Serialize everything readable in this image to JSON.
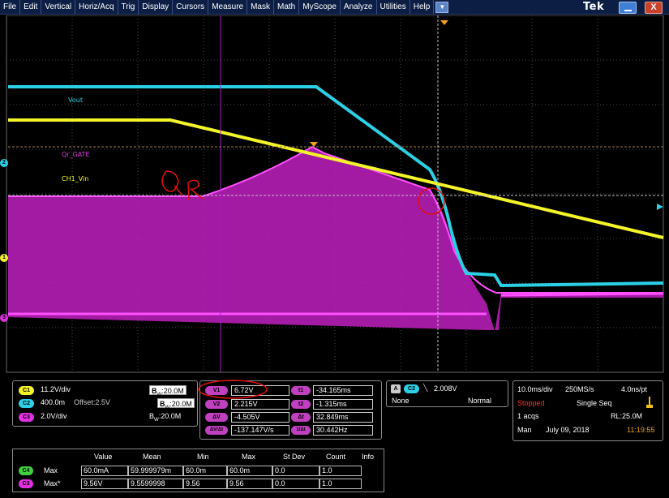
{
  "menu": {
    "items": [
      "File",
      "Edit",
      "Vertical",
      "Horiz/Acq",
      "Trig",
      "Display",
      "Cursors",
      "Measure",
      "Mask",
      "Math",
      "MyScope",
      "Analyze",
      "Utilities",
      "Help"
    ],
    "dropdown_glyph": "▼",
    "logo": "Tek",
    "close_glyph": "X"
  },
  "colors": {
    "ch1": "#f4f42a",
    "ch2": "#2cd0e6",
    "ch3": "#e030e0",
    "ch4": "#40d040",
    "cursor": "#a020a0",
    "grid": "#5a5a5a",
    "trigger": "#f0a020"
  },
  "traces": {
    "vout": "Vout",
    "qr_gate": "Qr_GATE",
    "vin": "CH1_Vin"
  },
  "channel_markers": {
    "ch1": "1",
    "ch2": "2",
    "ch3": "3"
  },
  "annotation_text": "QR",
  "vertical": {
    "ch1": {
      "badge": "C1",
      "scale": "11.2V/div",
      "bw": "20.0M"
    },
    "ch2": {
      "badge": "C2",
      "scale": "400.0m",
      "offset": "Offset:2.5V",
      "bw": "20.0M"
    },
    "ch3": {
      "badge": "C3",
      "scale": "2.0V/div",
      "bw": "20.0M"
    },
    "bw_prefix": "B",
    "bw_sub": "W",
    "bw_sep": ":"
  },
  "cursors": {
    "v1": {
      "label": "V1",
      "value": "6.72V"
    },
    "v2": {
      "label": "V2",
      "value": "2.215V"
    },
    "dv": {
      "label": "ΔV",
      "value": "-4.505V"
    },
    "dvdt": {
      "label": "ΔV/Δt",
      "value": "-137.147V/s"
    },
    "t1": {
      "label": "t1",
      "value": "-34.165ms"
    },
    "t2": {
      "label": "t2",
      "value": "-1.315ms"
    },
    "dt": {
      "label": "Δt",
      "value": "32.849ms"
    },
    "inv_dt": {
      "label": "1/Δt",
      "value": "30.442Hz"
    }
  },
  "trigger": {
    "mode_badge": "A",
    "source_badge": "C2",
    "slope_glyph": "╲",
    "level": "2.008V",
    "coupling": "None",
    "type": "Normal"
  },
  "acquisition": {
    "timebase": "10.0ms/div",
    "sample_rate": "250MS/s",
    "resolution": "4.0ns/pt",
    "status": "Stopped",
    "mode": "Single Seq",
    "acqs": "1 acqs",
    "record_length": "RL:25.0M",
    "trigger_mode": "Man",
    "date": "July 09, 2018",
    "time": "11:19:55"
  },
  "measurements": {
    "headers": [
      "Value",
      "Mean",
      "Min",
      "Max",
      "St Dev",
      "Count",
      "Info"
    ],
    "rows": [
      {
        "badge": "C4",
        "name": "Max",
        "value": "60.0mA",
        "mean": "59.999979m",
        "min": "60.0m",
        "max": "60.0m",
        "stdev": "0.0",
        "count": "1.0"
      },
      {
        "badge": "C3",
        "name": "Max*",
        "value": "9.56V",
        "mean": "9.5599998",
        "min": "9.56",
        "max": "9.56",
        "stdev": "0.0",
        "count": "1.0"
      }
    ]
  }
}
